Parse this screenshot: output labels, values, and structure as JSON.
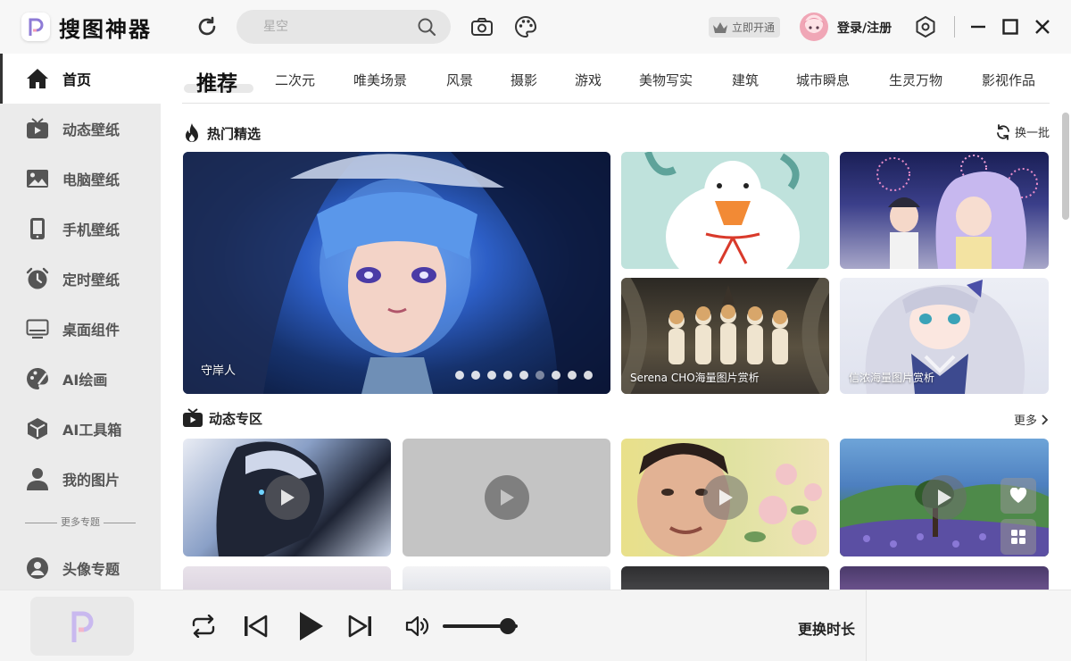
{
  "app": {
    "title": "搜图神器",
    "search": {
      "placeholder": "星空"
    },
    "vip_label": "立即开通",
    "login_label": "登录/注册"
  },
  "sidebar": {
    "items": [
      {
        "label": "首页",
        "icon": "home-icon"
      },
      {
        "label": "动态壁纸",
        "icon": "tv-icon"
      },
      {
        "label": "电脑壁纸",
        "icon": "image-icon"
      },
      {
        "label": "手机壁纸",
        "icon": "phone-icon"
      },
      {
        "label": "定时壁纸",
        "icon": "alarm-clock-icon"
      },
      {
        "label": "桌面组件",
        "icon": "monitor-icon"
      },
      {
        "label": "AI绘画",
        "icon": "palette-icon"
      },
      {
        "label": "AI工具箱",
        "icon": "toolbox-icon"
      },
      {
        "label": "我的图片",
        "icon": "user-icon"
      }
    ],
    "more_label": "更多专题",
    "extra_item": {
      "label": "头像专题",
      "icon": "avatar-icon"
    }
  },
  "tabs": [
    "推荐",
    "二次元",
    "唯美场景",
    "风景",
    "摄影",
    "游戏",
    "美物写实",
    "建筑",
    "城市瞬息",
    "生灵万物",
    "影视作品"
  ],
  "hot": {
    "title": "热门精选",
    "action": "换一批",
    "main_caption": "守岸人",
    "carousel_count": 9,
    "carousel_active": 5,
    "captions": [
      "Serena CHO海量图片赏析",
      "信浓海量图片赏析"
    ]
  },
  "dynamic": {
    "title": "动态专区",
    "action": "更多"
  },
  "player": {
    "change_duration": "更换时长",
    "volume": 0.87
  },
  "colors": {
    "accent": "#222222",
    "sidebar_bg": "#ebebeb"
  }
}
